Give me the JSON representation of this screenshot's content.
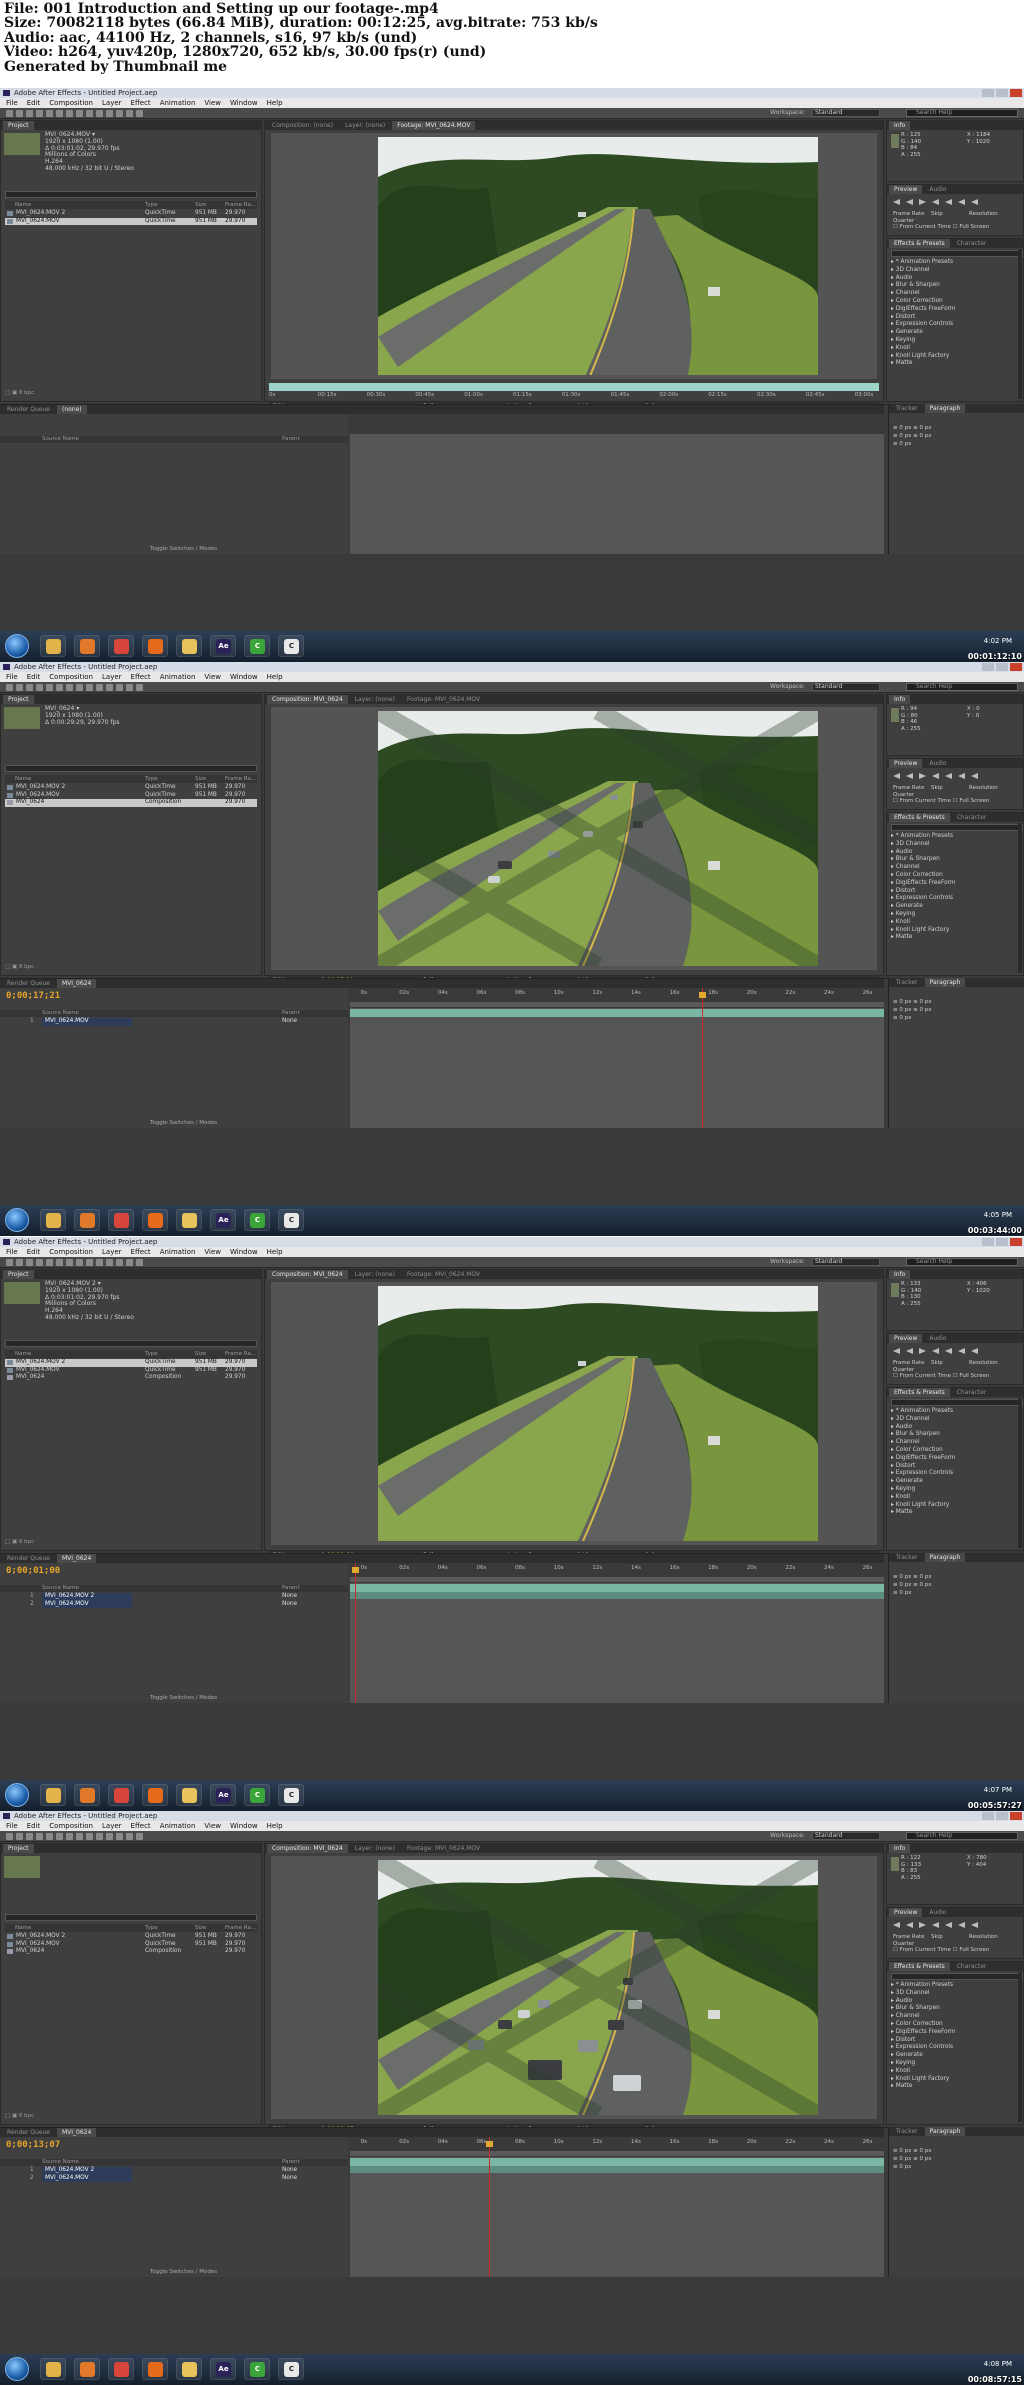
{
  "header": {
    "line1": "File: 001 Introduction and Setting up our footage-.mp4",
    "line2": "Size: 70082118 bytes (66.84 MiB), duration: 00:12:25, avg.bitrate: 753 kb/s",
    "line3": "Audio: aac, 44100 Hz, 2 channels, s16, 97 kb/s (und)",
    "line4": "Video: h264, yuv420p, 1280x720, 652 kb/s, 30.00 fps(r) (und)",
    "line5": "Generated by Thumbnail me"
  },
  "app": {
    "title": "Adobe After Effects - Untitled Project.aep",
    "menu": [
      "File",
      "Edit",
      "Composition",
      "Layer",
      "Effect",
      "Animation",
      "View",
      "Window",
      "Help"
    ],
    "workspace_label": "Workspace:",
    "workspace_value": "Standard",
    "search_placeholder": "Search Help",
    "project_tab": "Project",
    "info_tab": "Info",
    "preview_tabs": [
      "Preview",
      "Audio"
    ],
    "effects_tabs": [
      "Effects & Presets",
      "Character"
    ],
    "effects_list": [
      "* Animation Presets",
      "3D Channel",
      "Audio",
      "Blur & Sharpen",
      "Channel",
      "Color Correction",
      "DigiEffects FreeForm",
      "Distort",
      "Expression Controls",
      "Generate",
      "Keying",
      "Knoll",
      "Knoll Light Factory",
      "Matte"
    ],
    "preview_labels": {
      "frame_rate": "Frame Rate",
      "skip": "Skip",
      "resolution": "Resolution",
      "resolution_value": "Quarter",
      "from_current": "From Current Time",
      "full_screen": "Full Screen"
    },
    "project_columns": {
      "name": "Name",
      "type": "Type",
      "size": "Size",
      "frame_rate": "Frame Ra..."
    },
    "timeline_columns": {
      "source": "Source Name",
      "parent": "Parent"
    },
    "right_tabs": [
      "Tracker",
      "Paragraph"
    ],
    "toggle_label": "Toggle Switches / Modes",
    "zoom": "50%",
    "resolution": "Full",
    "camera": "Active Camera",
    "view": "1 View",
    "bpc": "8 bpc",
    "taskbar_ae": "Ae"
  },
  "frames": [
    {
      "viewer_tabs": [
        "Composition: (none)",
        "Layer: (none)",
        "Footage: MVI_0624.MOV"
      ],
      "project_selected_name": "MVI_0624.MOV",
      "project_info": [
        "1920 x 1080 (1.00)",
        "Δ 0:03:01:02, 29.970 fps",
        "Millions of Colors",
        "H.264",
        "48.000 kHz / 32 bit U / Stereo"
      ],
      "project_items": [
        {
          "name": "MVI_0624.MOV 2",
          "type": "QuickTime",
          "size": "951 MB",
          "fr": "29.970",
          "sel": false,
          "comp": false
        },
        {
          "name": "MVI_0624.MOV",
          "type": "QuickTime",
          "size": "951 MB",
          "fr": "29.970",
          "sel": true,
          "comp": false
        }
      ],
      "info": {
        "r": "R : 125",
        "g": "G : 140",
        "b": "B : 84",
        "a": "A : 255",
        "x": "X : 1184",
        "y": "Y : 1020"
      },
      "timecode": "",
      "timeline_tabs": [
        "Render Queue",
        "(none)"
      ],
      "layers": [],
      "footage_view": true,
      "footage_ruler": [
        "0s",
        "00:15s",
        "00:30s",
        "00:45s",
        "01:00s",
        "01:15s",
        "01:30s",
        "01:45s",
        "02:00s",
        "02:15s",
        "02:30s",
        "02:45s",
        "03:00s"
      ],
      "footage_timecode": "0:00:00:00",
      "footage_in": "0:00:30:00",
      "footage_dur": "0:03:01:02",
      "time_ruler": [],
      "cti_pct": null,
      "clock_time": "4:02 PM",
      "stamp": "00:01:12:10",
      "scene": 1
    },
    {
      "viewer_tabs": [
        "Composition: MVI_0624",
        "Layer: (none)",
        "Footage: MVI_0624.MOV"
      ],
      "project_selected_name": "MVI_0624",
      "project_info": [
        "1920 x 1080 (1.00)",
        "Δ 0:00:29:29, 29.970 fps"
      ],
      "project_items": [
        {
          "name": "MVI_0624.MOV 2",
          "type": "QuickTime",
          "size": "951 MB",
          "fr": "29.970",
          "sel": false,
          "comp": false
        },
        {
          "name": "MVI_0624.MOV",
          "type": "QuickTime",
          "size": "951 MB",
          "fr": "29.970",
          "sel": false,
          "comp": false
        },
        {
          "name": "MVI_0624",
          "type": "Composition",
          "size": "",
          "fr": "29.970",
          "sel": true,
          "comp": true
        }
      ],
      "info": {
        "r": "R : 94",
        "g": "G : 80",
        "b": "B : 46",
        "a": "A : 255",
        "x": "X : 0",
        "y": "Y : 0"
      },
      "timecode": "0;00;17;21",
      "timeline_tabs": [
        "Render Queue",
        "MVI_0624"
      ],
      "layers": [
        {
          "index": "1",
          "name": "MVI_0624.MOV",
          "mode": "None"
        }
      ],
      "footage_view": false,
      "time_ruler": [
        "0s",
        "02s",
        "04s",
        "06s",
        "08s",
        "10s",
        "12s",
        "14s",
        "16s",
        "18s",
        "20s",
        "22s",
        "24s",
        "26s"
      ],
      "cti_pct": 0.66,
      "clock_time": "4:05 PM",
      "stamp": "00:03:44:00",
      "scene": 2
    },
    {
      "viewer_tabs": [
        "Composition: MVI_0624",
        "Layer: (none)",
        "Footage: MVI_0624.MOV"
      ],
      "project_selected_name": "MVI_0624.MOV 2",
      "project_info": [
        "1920 x 1080 (1.00)",
        "Δ 0:03:01:02, 29.970 fps",
        "Millions of Colors",
        "H.264",
        "48.000 kHz / 32 bit U / Stereo"
      ],
      "project_items": [
        {
          "name": "MVI_0624.MOV 2",
          "type": "QuickTime",
          "size": "951 MB",
          "fr": "29.970",
          "sel": true,
          "comp": false
        },
        {
          "name": "MVI_0624.MOV",
          "type": "QuickTime",
          "size": "951 MB",
          "fr": "29.970",
          "sel": false,
          "comp": false
        },
        {
          "name": "MVI_0624",
          "type": "Composition",
          "size": "",
          "fr": "29.970",
          "sel": false,
          "comp": true
        }
      ],
      "info": {
        "r": "R : 133",
        "g": "G : 140",
        "b": "B : 130",
        "a": "A : 255",
        "x": "X : 406",
        "y": "Y : 1020"
      },
      "timecode": "0;00;01;00",
      "timeline_tabs": [
        "Render Queue",
        "MVI_0624"
      ],
      "layers": [
        {
          "index": "1",
          "name": "MVI_0624.MOV 2",
          "mode": "None"
        },
        {
          "index": "2",
          "name": "MVI_0624.MOV",
          "mode": "None"
        }
      ],
      "footage_view": false,
      "time_ruler": [
        "0s",
        "02s",
        "04s",
        "06s",
        "08s",
        "10s",
        "12s",
        "14s",
        "16s",
        "18s",
        "20s",
        "22s",
        "24s",
        "26s"
      ],
      "cti_pct": 0.01,
      "clock_time": "4:07 PM",
      "stamp": "00:05:57:27",
      "scene": 1
    },
    {
      "viewer_tabs": [
        "Composition: MVI_0624",
        "Layer: (none)",
        "Footage: MVI_0624.MOV"
      ],
      "project_selected_name": "",
      "project_info": [],
      "project_items": [
        {
          "name": "MVI_0624.MOV 2",
          "type": "QuickTime",
          "size": "951 MB",
          "fr": "29.970",
          "sel": false,
          "comp": false
        },
        {
          "name": "MVI_0624.MOV",
          "type": "QuickTime",
          "size": "951 MB",
          "fr": "29.970",
          "sel": false,
          "comp": false
        },
        {
          "name": "MVI_0624",
          "type": "Composition",
          "size": "",
          "fr": "29.970",
          "sel": false,
          "comp": true
        }
      ],
      "info": {
        "r": "R : 122",
        "g": "G : 133",
        "b": "B : 83",
        "a": "A : 255",
        "x": "X : 780",
        "y": "Y : 404"
      },
      "timecode": "0;00;13;07",
      "timeline_tabs": [
        "Render Queue",
        "MVI_0624"
      ],
      "layers": [
        {
          "index": "1",
          "name": "MVI_0624.MOV 2",
          "mode": "None"
        },
        {
          "index": "2",
          "name": "MVI_0624.MOV",
          "mode": "None"
        }
      ],
      "footage_view": false,
      "time_ruler": [
        "0s",
        "02s",
        "04s",
        "06s",
        "08s",
        "10s",
        "12s",
        "14s",
        "16s",
        "18s",
        "20s",
        "22s",
        "24s",
        "26s"
      ],
      "cti_pct": 0.26,
      "clock_time": "4:08 PM",
      "stamp": "00:08:57:15",
      "scene": 3
    }
  ]
}
